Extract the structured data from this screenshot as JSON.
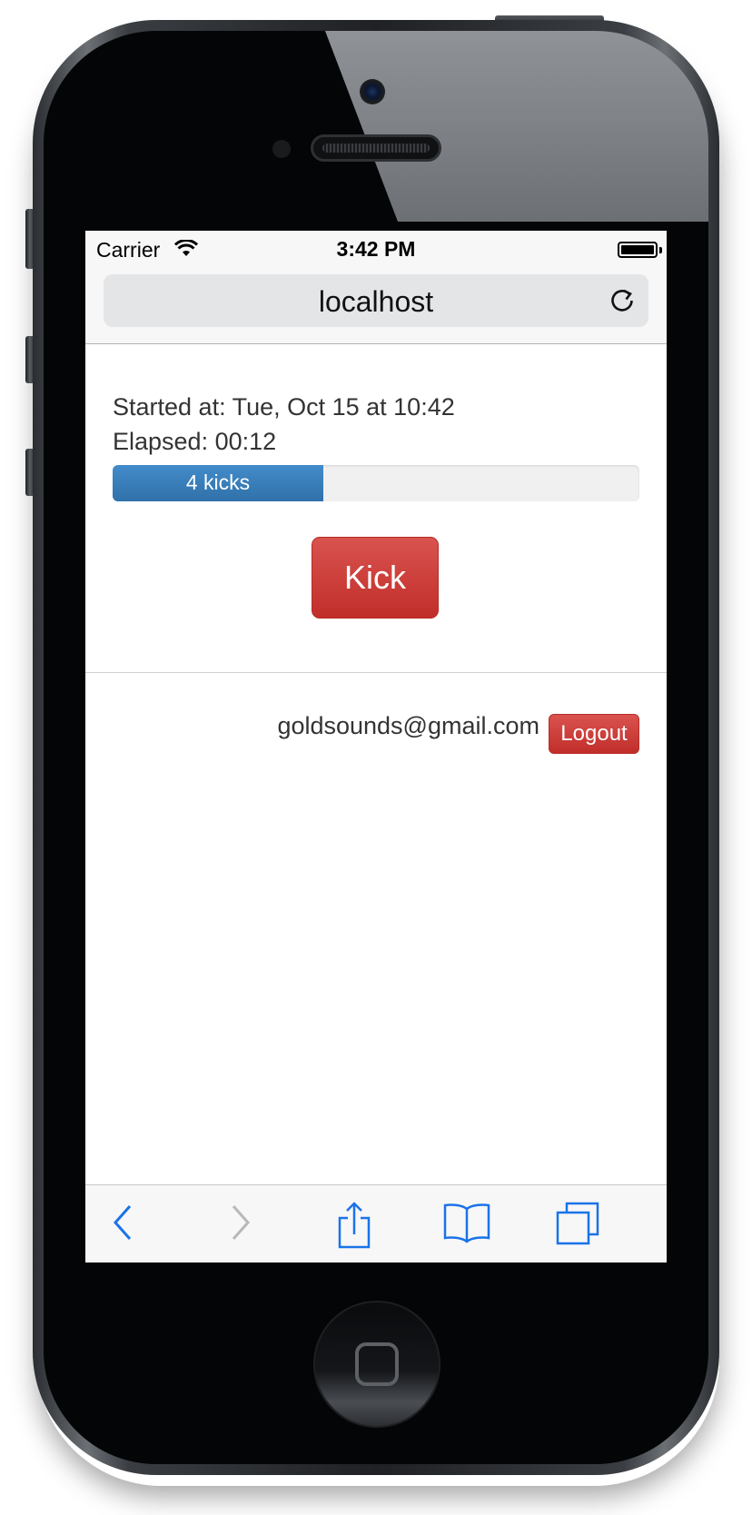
{
  "status_bar": {
    "carrier": "Carrier",
    "time": "3:42 PM",
    "wifi_icon": "wifi-icon",
    "battery_icon": "battery-icon"
  },
  "browser": {
    "url": "localhost",
    "reload_icon": "reload-icon"
  },
  "page": {
    "started_text": "Started at: Tue, Oct 15 at 10:42",
    "elapsed_text": "Elapsed: 00:12",
    "progress": {
      "label": "4 kicks",
      "fraction": 0.4,
      "color": "#428bca"
    },
    "kick_label": "Kick",
    "user_email": "goldsounds@gmail.com",
    "logout_label": "Logout",
    "button_color": "#d9534f"
  },
  "toolbar": {
    "icons": [
      "back-icon",
      "forward-icon",
      "share-icon",
      "bookmarks-icon",
      "tabs-icon"
    ],
    "accent": "#1a73e8"
  }
}
